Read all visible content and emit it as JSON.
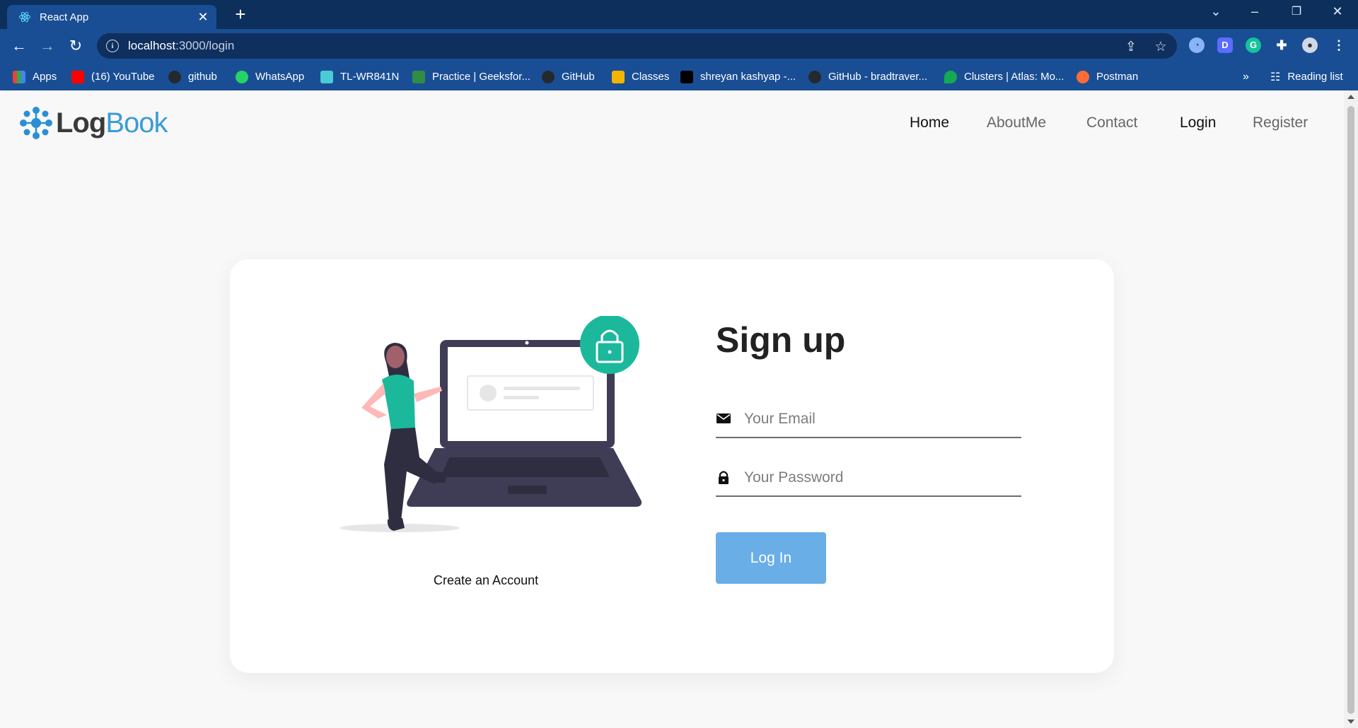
{
  "browser": {
    "tab_title": "React App",
    "url_host": "localhost",
    "url_path": ":3000/login",
    "bookmarks": [
      {
        "label": "Apps",
        "icon": "apps-grid-icon",
        "color": "#ea4335"
      },
      {
        "label": "(16) YouTube",
        "icon": "youtube-icon",
        "color": "#ff0000"
      },
      {
        "label": "github",
        "icon": "github-icon",
        "color": "#24292e"
      },
      {
        "label": "WhatsApp",
        "icon": "whatsapp-icon",
        "color": "#25d366"
      },
      {
        "label": "TL-WR841N",
        "icon": "tplink-icon",
        "color": "#4acbd6"
      },
      {
        "label": "Practice | Geeksfor...",
        "icon": "geeksforgeeks-icon",
        "color": "#2f8d46"
      },
      {
        "label": "GitHub",
        "icon": "github-icon",
        "color": "#24292e"
      },
      {
        "label": "Classes",
        "icon": "classroom-icon",
        "color": "#f4b400"
      },
      {
        "label": "shreyan kashyap -...",
        "icon": "hackerrank-icon",
        "color": "#000000"
      },
      {
        "label": "GitHub - bradtraver...",
        "icon": "github-icon",
        "color": "#24292e"
      },
      {
        "label": "Clusters | Atlas: Mo...",
        "icon": "mongodb-leaf-icon",
        "color": "#13aa52"
      },
      {
        "label": "Postman",
        "icon": "postman-icon",
        "color": "#ff6c37"
      }
    ],
    "more_bookmarks": "»",
    "reading_list": "Reading list"
  },
  "app": {
    "logo_part1": "Log",
    "logo_part2": "Book",
    "nav": [
      "Home",
      "AboutMe",
      "Contact",
      "Login",
      "Register"
    ],
    "form": {
      "title": "Sign up",
      "email_placeholder": "Your Email",
      "password_placeholder": "Your Password",
      "submit": "Log In"
    },
    "create_account": "Create an Account"
  },
  "colors": {
    "browser_dark": "#0c2f5c",
    "browser_blue": "#1a4e94",
    "accent_teal": "#1cb89c",
    "button_blue": "#6aaee8",
    "logo_blue": "#3b9bd8"
  }
}
